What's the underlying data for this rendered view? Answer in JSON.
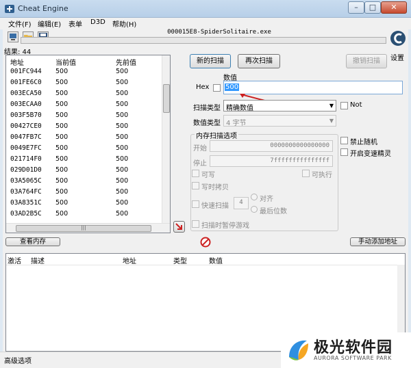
{
  "window": {
    "title": "Cheat Engine",
    "minimize": "–",
    "maximize": "□",
    "close": "✕"
  },
  "menu": [
    "文件(F)",
    "编辑(E)",
    "表单",
    "D3D",
    "帮助(H)"
  ],
  "process": {
    "name": "000015E8-SpiderSolitaire.exe"
  },
  "settings_label": "设置",
  "results": {
    "label": "结果: 44"
  },
  "address_list": {
    "columns": [
      "地址",
      "当前值",
      "先前值"
    ],
    "rows": [
      {
        "address": "001FC944",
        "current": "500",
        "previous": "500"
      },
      {
        "address": "001FE6C0",
        "current": "500",
        "previous": "500"
      },
      {
        "address": "003ECA50",
        "current": "500",
        "previous": "500"
      },
      {
        "address": "003ECAA0",
        "current": "500",
        "previous": "500"
      },
      {
        "address": "003F5B70",
        "current": "500",
        "previous": "500"
      },
      {
        "address": "00427CE0",
        "current": "500",
        "previous": "500"
      },
      {
        "address": "0047FB7C",
        "current": "500",
        "previous": "500"
      },
      {
        "address": "0049E7FC",
        "current": "500",
        "previous": "500"
      },
      {
        "address": "021714F0",
        "current": "500",
        "previous": "500"
      },
      {
        "address": "029D01D0",
        "current": "500",
        "previous": "500"
      },
      {
        "address": "03A5065C",
        "current": "500",
        "previous": "500"
      },
      {
        "address": "03A764FC",
        "current": "500",
        "previous": "500"
      },
      {
        "address": "03A8351C",
        "current": "500",
        "previous": "500"
      },
      {
        "address": "03AD2B5C",
        "current": "500",
        "previous": "500"
      }
    ],
    "hscroll_grip": "|||"
  },
  "scan": {
    "new_scan": "新的扫描",
    "next_scan": "再次扫描",
    "undo_scan": "撤销扫描",
    "value_label": "数值",
    "hex_label": "Hex",
    "value": "500",
    "scan_type_label": "扫描类型",
    "scan_type_value": "精确数值",
    "not_label": "Not",
    "value_type_label": "数值类型",
    "value_type_value": "4 字节"
  },
  "memory_options": {
    "title": "内存扫描选项",
    "start_label": "开始",
    "start_value": "0000000000000000",
    "stop_label": "停止",
    "stop_value": "7fffffffffffffff",
    "writable": "可写",
    "executable": "可执行",
    "copy_on_write": "写时拷贝",
    "fast_scan": "快速扫描",
    "fast_scan_value": "4",
    "align": "对齐",
    "last_digits": "最后位数",
    "pause_game": "扫描时暂停游戏"
  },
  "right_options": {
    "disable_random": "禁止随机",
    "speedhack": "开启变速精灵"
  },
  "buttons": {
    "view_memory": "查看内存",
    "add_address_manually": "手动添加地址"
  },
  "cheat_table": {
    "columns": [
      "激活",
      "描述",
      "地址",
      "类型",
      "数值"
    ]
  },
  "status": {
    "advanced_options": "高级选项"
  },
  "watermark": {
    "brand": "极光软件园",
    "sub": "AURORA SOFTWARE PARK"
  },
  "colors": {
    "selection": "#3399ff",
    "stop_icon": "#cc2222",
    "arrow": "#cc2020",
    "accent": "#7aa7d7"
  }
}
